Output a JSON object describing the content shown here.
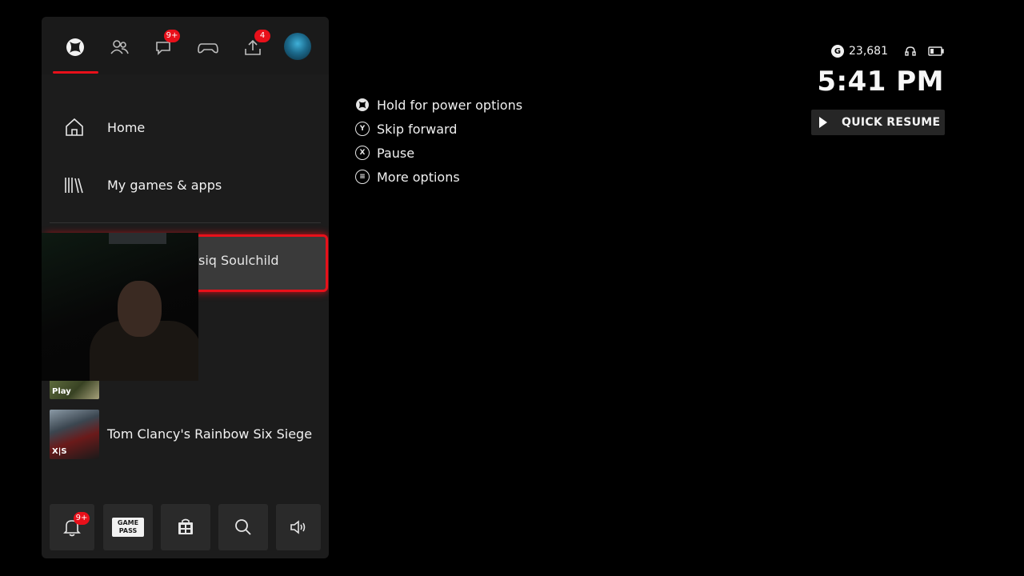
{
  "guide": {
    "tabs": [
      {
        "name": "xbox",
        "icon": "xbox-logo-icon"
      },
      {
        "name": "people",
        "icon": "people-icon"
      },
      {
        "name": "parties-chats",
        "icon": "chat-icon",
        "badge": "9+"
      },
      {
        "name": "capture",
        "icon": "controller-icon"
      },
      {
        "name": "upload",
        "icon": "upload-icon",
        "badge": "4"
      },
      {
        "name": "profile",
        "icon": "avatar"
      }
    ],
    "nav": {
      "home": "Home",
      "my_games": "My games & apps"
    },
    "focused_item": "siq Soulchild",
    "recent": [
      {
        "title": "",
        "thumb_tag": "Play"
      },
      {
        "title": "Tom Clancy's Rainbow Six Siege",
        "thumb_tag": "X|S"
      }
    ],
    "bottom_bar": {
      "notifications_badge": "9+",
      "gamepass_line1": "GAME",
      "gamepass_line2": "PASS"
    }
  },
  "hints": [
    {
      "icon": "xbox-button-icon",
      "glyph": "",
      "label": "Hold for power options"
    },
    {
      "icon": "y-button-icon",
      "glyph": "Y",
      "label": "Skip forward"
    },
    {
      "icon": "x-button-icon",
      "glyph": "X",
      "label": "Pause"
    },
    {
      "icon": "menu-button-icon",
      "glyph": "≡",
      "label": "More options"
    }
  ],
  "status": {
    "gamerscore": "23,681",
    "time": "5:41 PM",
    "quick_resume": "QUICK RESUME"
  },
  "colors": {
    "accent": "#e8101a",
    "panel": "#1c1c1c",
    "background": "#000000"
  }
}
